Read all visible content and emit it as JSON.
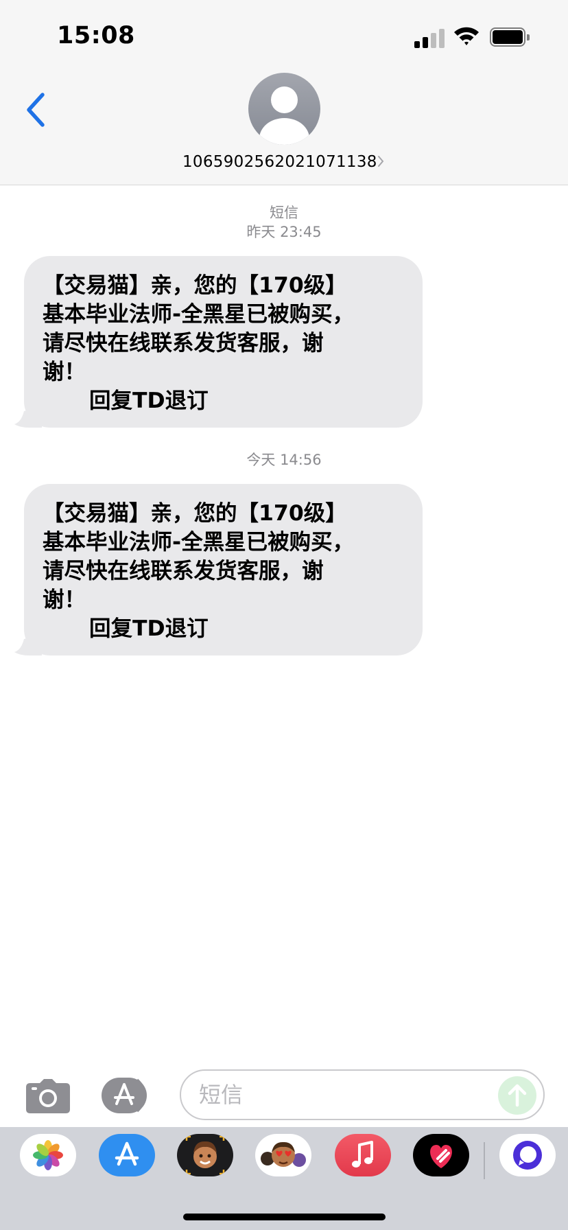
{
  "status_bar": {
    "time": "15:08"
  },
  "header": {
    "contact": "1065902562021071138"
  },
  "messages": [
    {
      "service": "短信",
      "timestamp": "昨天 23:45",
      "text": "【交易猫】亲，您的【170级】\n基本毕业法师-全黑星已被购买，\n请尽快在线联系发货客服，谢\n谢！",
      "unsubscribe": "回复TD退订"
    },
    {
      "timestamp": "今天 14:56",
      "text": "【交易猫】亲，您的【170级】\n基本毕业法师-全黑星已被购买，\n请尽快在线联系发货客服，谢\n谢！",
      "unsubscribe": "回复TD退订"
    }
  ],
  "input": {
    "placeholder": "短信"
  },
  "app_drawer": {
    "apps": [
      "photos-app-icon",
      "app-store-icon",
      "memoji-icon",
      "animoji-stickers-icon",
      "music-icon",
      "digital-touch-icon",
      "more-app-icon"
    ]
  },
  "colors": {
    "accent": "#1f72e6",
    "bubble": "#e9e9eb",
    "send_disabled": "#d9f2dc"
  }
}
